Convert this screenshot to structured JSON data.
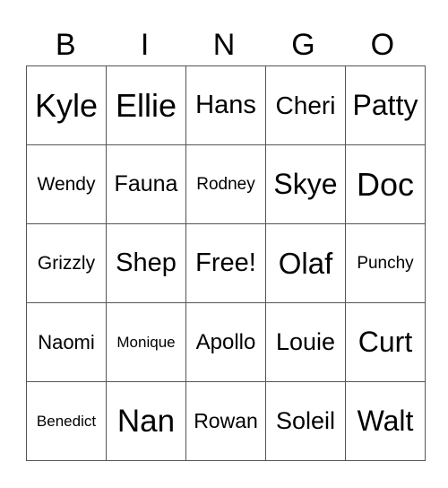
{
  "header": [
    "B",
    "I",
    "N",
    "G",
    "O"
  ],
  "rows": [
    [
      {
        "text": "Kyle",
        "size": 36
      },
      {
        "text": "Ellie",
        "size": 36
      },
      {
        "text": "Hans",
        "size": 29
      },
      {
        "text": "Cheri",
        "size": 28
      },
      {
        "text": "Patty",
        "size": 32
      }
    ],
    [
      {
        "text": "Wendy",
        "size": 21
      },
      {
        "text": "Fauna",
        "size": 25
      },
      {
        "text": "Rodney",
        "size": 19
      },
      {
        "text": "Skye",
        "size": 32
      },
      {
        "text": "Doc",
        "size": 36
      }
    ],
    [
      {
        "text": "Grizzly",
        "size": 21
      },
      {
        "text": "Shep",
        "size": 29
      },
      {
        "text": "Free!",
        "size": 29
      },
      {
        "text": "Olaf",
        "size": 33
      },
      {
        "text": "Punchy",
        "size": 19
      }
    ],
    [
      {
        "text": "Naomi",
        "size": 22
      },
      {
        "text": "Monique",
        "size": 17
      },
      {
        "text": "Apollo",
        "size": 24
      },
      {
        "text": "Louie",
        "size": 27
      },
      {
        "text": "Curt",
        "size": 32
      }
    ],
    [
      {
        "text": "Benedict",
        "size": 17
      },
      {
        "text": "Nan",
        "size": 35
      },
      {
        "text": "Rowan",
        "size": 23
      },
      {
        "text": "Soleil",
        "size": 27
      },
      {
        "text": "Walt",
        "size": 32
      }
    ]
  ]
}
